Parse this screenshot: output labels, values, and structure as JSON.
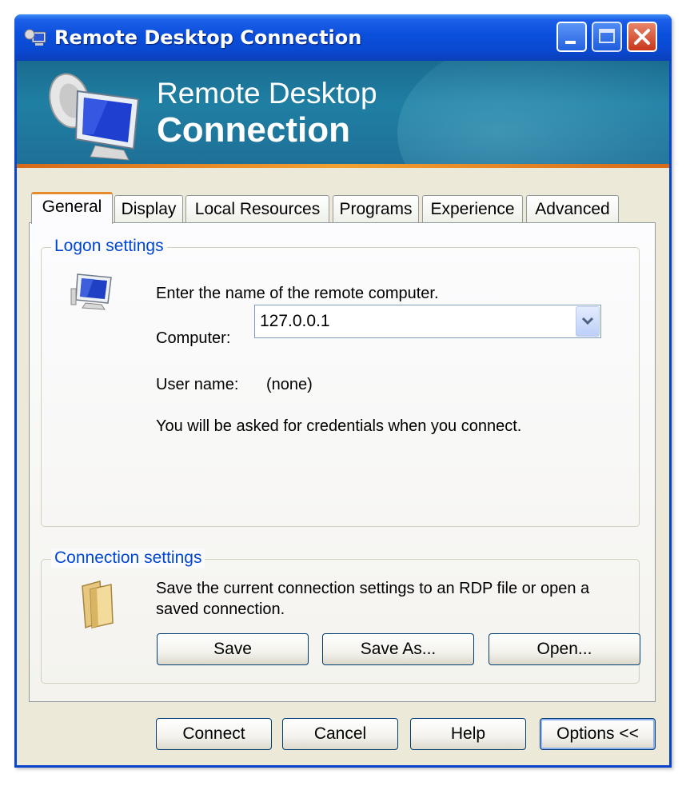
{
  "window": {
    "title": "Remote Desktop Connection",
    "icon": "remote-desktop-icon",
    "controls": {
      "minimize": "minimize-icon",
      "maximize": "maximize-icon",
      "close": "close-icon"
    }
  },
  "banner": {
    "line1": "Remote Desktop",
    "line2": "Connection",
    "icon": "monitor-satellite-icon"
  },
  "tabs": [
    {
      "label": "General",
      "active": true
    },
    {
      "label": "Display"
    },
    {
      "label": "Local Resources"
    },
    {
      "label": "Programs"
    },
    {
      "label": "Experience"
    },
    {
      "label": "Advanced"
    }
  ],
  "logon": {
    "group_label": "Logon settings",
    "instruction": "Enter the name of the remote computer.",
    "computer_label": "Computer:",
    "computer_value": "127.0.0.1",
    "username_label": "User name:",
    "username_value": "(none)",
    "credentials_note": "You will be asked for credentials when you connect."
  },
  "connection": {
    "group_label": "Connection settings",
    "description_line1": "Save the current connection settings to an RDP file or open a",
    "description_line2": "saved connection.",
    "save_label": "Save",
    "save_as_label": "Save As...",
    "open_label": "Open..."
  },
  "footer": {
    "connect_label": "Connect",
    "cancel_label": "Cancel",
    "help_label": "Help",
    "options_label": "Options <<"
  },
  "colors": {
    "titlebar": "#0a4fdc",
    "banner": "#1f7fa3",
    "accent_stripe": "#f2a132",
    "group_label": "#0046d5"
  }
}
